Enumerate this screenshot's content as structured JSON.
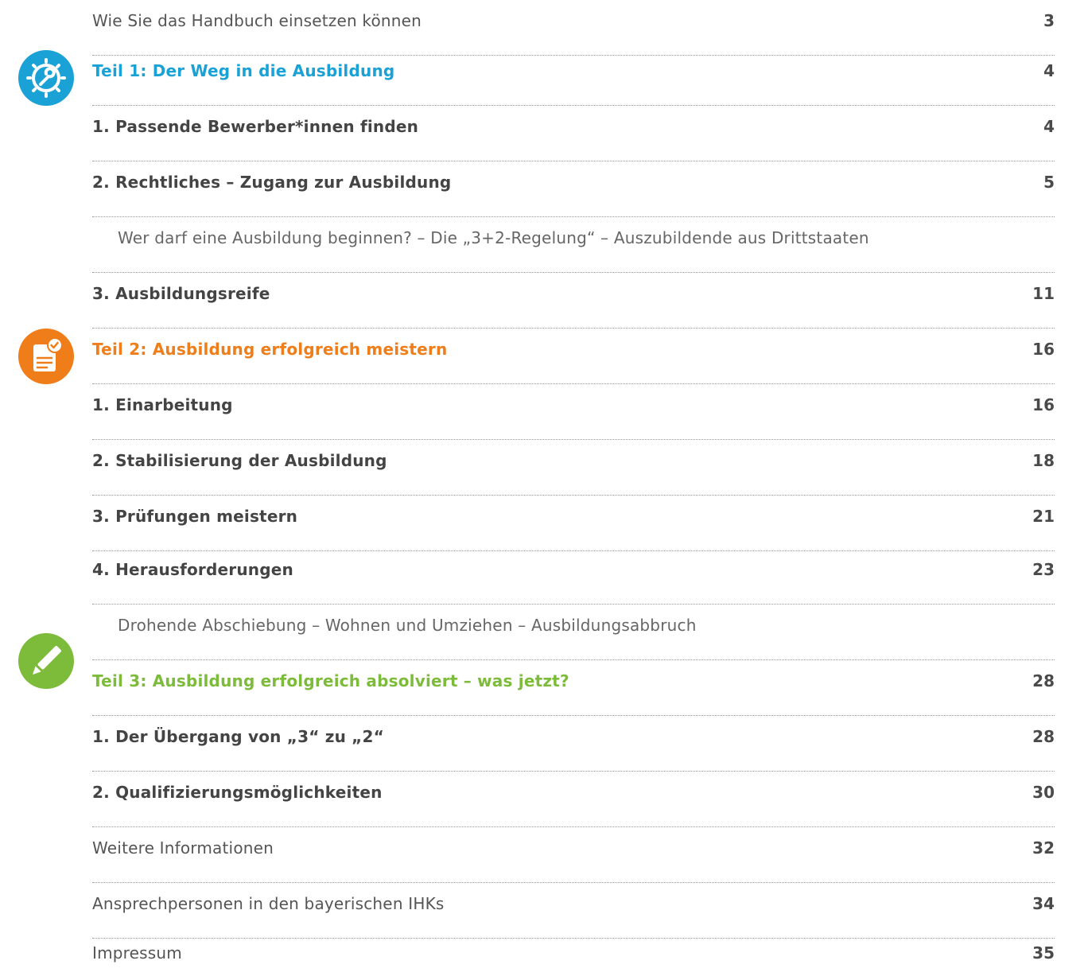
{
  "toc": {
    "entries": [
      {
        "title": "Wie Sie das Handbuch einsetzen können",
        "page": "3"
      },
      {
        "title": "Teil 1: Der Weg in die Ausbildung",
        "page": "4"
      },
      {
        "title": "1. Passende Bewerber*innen finden",
        "page": "4"
      },
      {
        "title": "2. Rechtliches – Zugang zur Ausbildung",
        "page": "5"
      },
      {
        "title": "Wer darf eine Ausbildung beginnen? – Die „3+2-Regelung“ – Auszubildende aus Drittstaaten",
        "page": ""
      },
      {
        "title": "3. Ausbildungsreife",
        "page": "11"
      },
      {
        "title": "Teil 2: Ausbildung erfolgreich meistern",
        "page": "16"
      },
      {
        "title": "1. Einarbeitung",
        "page": "16"
      },
      {
        "title": "2. Stabilisierung der Ausbildung",
        "page": "18"
      },
      {
        "title": "3. Prüfungen meistern",
        "page": "21"
      },
      {
        "title": "4. Herausforderungen",
        "page": "23"
      },
      {
        "title": "Drohende Abschiebung – Wohnen und Umziehen – Ausbildungsabbruch",
        "page": ""
      },
      {
        "title": "Teil 3: Ausbildung erfolgreich absolviert – was jetzt?",
        "page": "28"
      },
      {
        "title": "1. Der Übergang von „3“ zu „2“",
        "page": "28"
      },
      {
        "title": "2. Qualifizierungsmöglichkeiten",
        "page": "30"
      },
      {
        "title": "Weitere Informationen",
        "page": "32"
      },
      {
        "title": "Ansprechpersonen in den bayerischen IHKs",
        "page": "34"
      },
      {
        "title": "Impressum",
        "page": "35"
      }
    ]
  },
  "icons": {
    "part1": "wrench-gear-icon",
    "part2": "document-check-icon",
    "part3": "pencil-icon"
  },
  "colors": {
    "part1": "#1aa1d6",
    "part2": "#ef7d1a",
    "part3": "#7dbb3a",
    "text": "#444444",
    "rule": "#9a9a9a"
  }
}
